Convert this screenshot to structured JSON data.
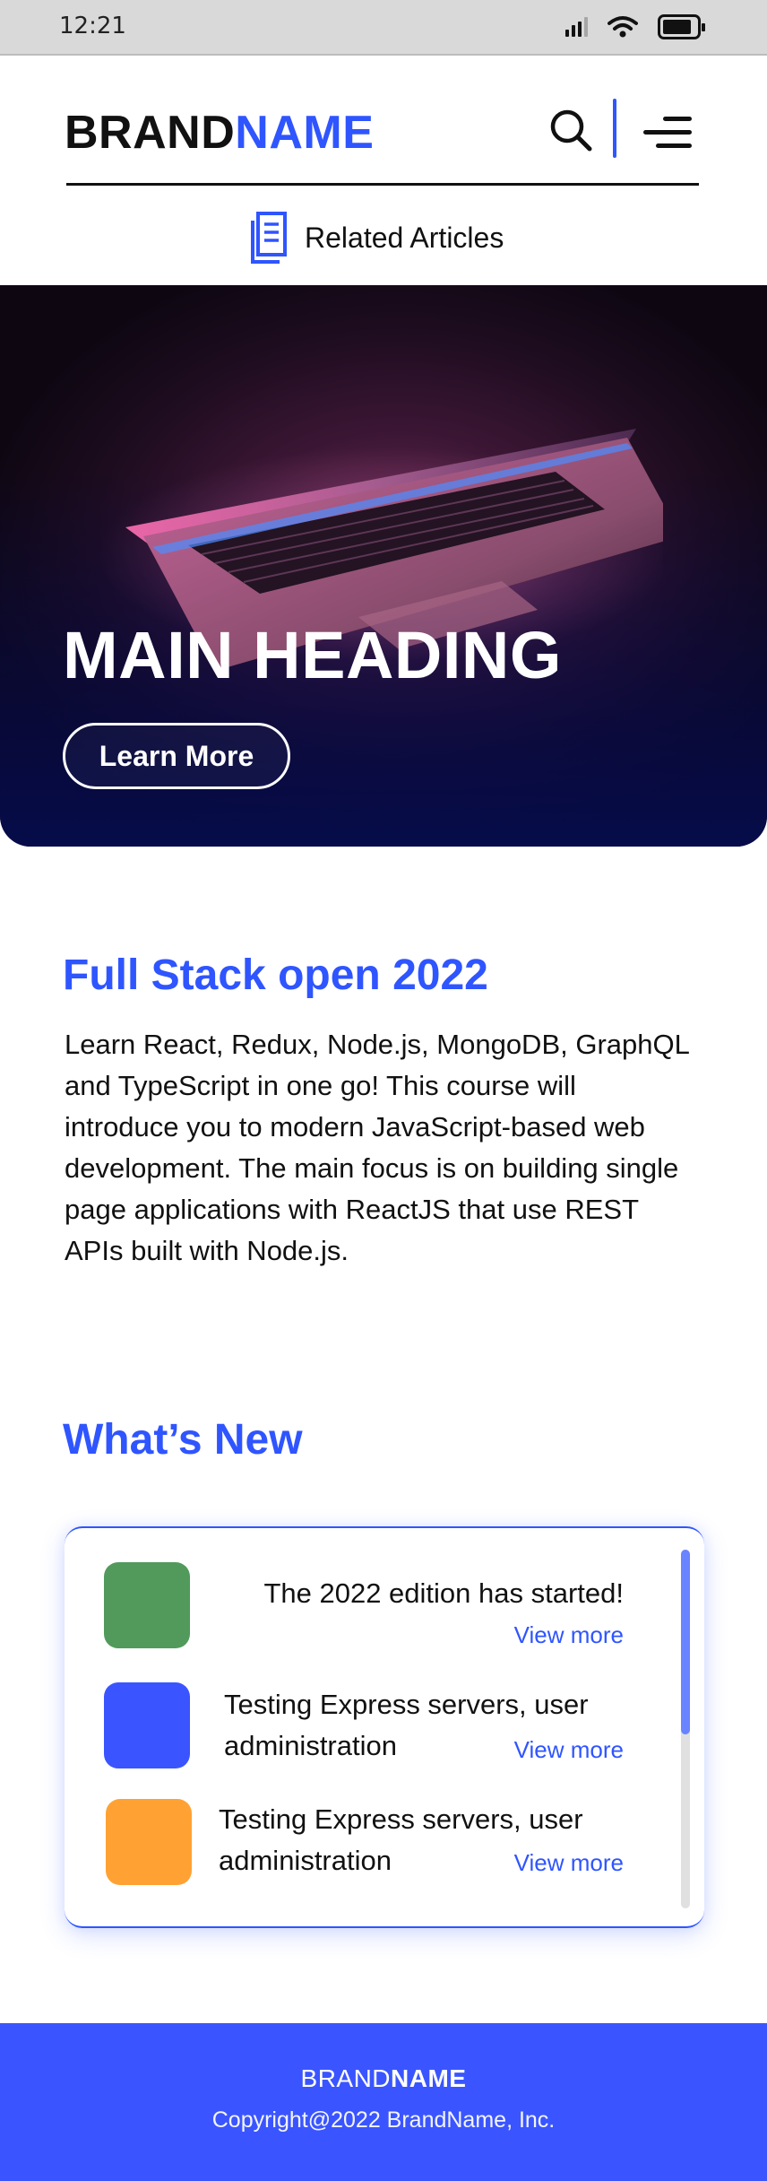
{
  "status_bar": {
    "time": "12:21",
    "icons": [
      "signal-icon",
      "wifi-icon",
      "battery-icon"
    ],
    "battery_level": 0.85
  },
  "header": {
    "brand_part1": "BRAND",
    "brand_part2": "NAME",
    "related_label": "Related Articles",
    "icons": [
      "search-icon",
      "menu-icon",
      "document-icon"
    ]
  },
  "hero": {
    "heading": "MAIN HEADING",
    "button_label": "Learn More"
  },
  "intro": {
    "title": "Full Stack open 2022",
    "body": "Learn React, Redux, Node.js, MongoDB, GraphQL and TypeScript in one go! This course will introduce you to modern JavaScript-based web development. The main focus is on building single page applications with ReactJS that use REST APIs built with Node.js."
  },
  "whats_new": {
    "title": "What’s New",
    "items": [
      {
        "text": "The 2022 edition has started!",
        "link": "View more",
        "color": "#519a5c"
      },
      {
        "text": "Testing Express servers, user administration",
        "link": "View more",
        "color": "#3a55ff"
      },
      {
        "text": "Testing Express servers, user administration",
        "link": "View more",
        "color": "#ffa233"
      }
    ]
  },
  "footer": {
    "brand_part1": "BRAND",
    "brand_part2": "NAME",
    "copyright": "Copyright@2022 BrandName, Inc."
  },
  "colors": {
    "accent": "#2f55ff",
    "footer_bg": "#3a55ff",
    "hero_bottom": "#060c4a"
  }
}
